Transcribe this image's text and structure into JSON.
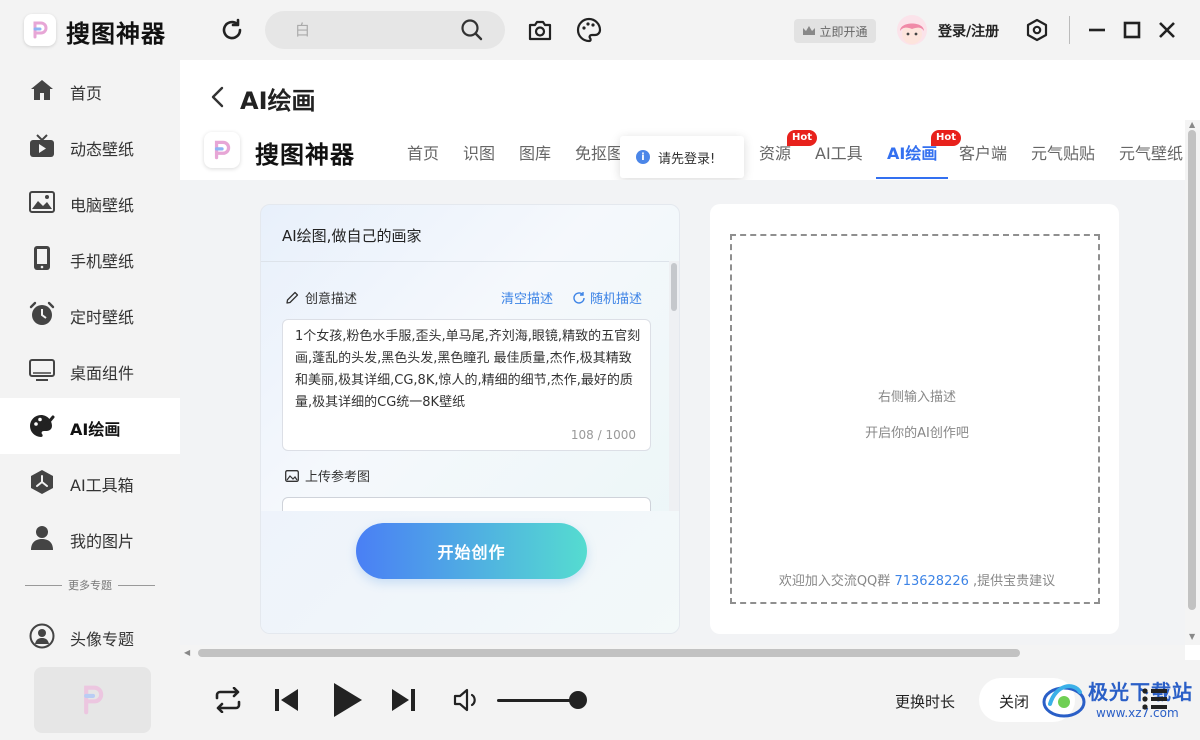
{
  "app": {
    "title": "搜图神器",
    "search_placeholder": "白",
    "vip_label": "立即开通",
    "login_label": "登录/注册"
  },
  "sidebar": {
    "items": [
      {
        "label": "首页",
        "icon": "home-icon"
      },
      {
        "label": "动态壁纸",
        "icon": "tv-icon"
      },
      {
        "label": "电脑壁纸",
        "icon": "image-icon"
      },
      {
        "label": "手机壁纸",
        "icon": "phone-icon"
      },
      {
        "label": "定时壁纸",
        "icon": "alarm-clock-icon"
      },
      {
        "label": "桌面组件",
        "icon": "monitor-icon"
      },
      {
        "label": "AI绘画",
        "icon": "palette-icon"
      },
      {
        "label": "AI工具箱",
        "icon": "ai-toolbox-icon"
      },
      {
        "label": "我的图片",
        "icon": "user-icon"
      }
    ],
    "more_topics": "更多专题",
    "topic_items": [
      {
        "label": "头像专题",
        "icon": "avatar-topic-icon"
      }
    ],
    "active": "AI绘画"
  },
  "page": {
    "title": "AI绘画",
    "site_brand": "搜图神器",
    "nav": [
      {
        "label": "首页"
      },
      {
        "label": "识图"
      },
      {
        "label": "图库"
      },
      {
        "label": "免抠图"
      },
      {
        "label": "资源",
        "badge": "Hot"
      },
      {
        "label": "AI工具"
      },
      {
        "label": "AI绘画",
        "badge": "Hot",
        "active": true
      },
      {
        "label": "客户端"
      },
      {
        "label": "元气贴贴"
      },
      {
        "label": "元气壁纸"
      }
    ],
    "toast": "请先登录!"
  },
  "left_card": {
    "title": "AI绘图,做自己的画家",
    "creative_label": "创意描述",
    "clear_label": "清空描述",
    "random_label": "随机描述",
    "description": "1个女孩,粉色水手服,歪头,单马尾,齐刘海,眼镜,精致的五官刻画,蓬乱的头发,黑色头发,黑色瞳孔 最佳质量,杰作,极其精致和美丽,极其详细,CG,8K,惊人的,精细的细节,杰作,最好的质量,极其详细的CG统一8K壁纸",
    "count": "108 / 1000",
    "upload_label": "上传参考图",
    "start_button": "开始创作"
  },
  "right_card": {
    "hint1": "右侧输入描述",
    "hint2": "开启你的AI创作吧",
    "qq_prefix": "欢迎加入交流QQ群",
    "qq_number": "713628226",
    "qq_suffix": ",提供宝贵建议"
  },
  "player": {
    "change_duration": "更换时长",
    "close": "关闭",
    "volume_level": 0.88
  },
  "watermark": {
    "text1": "极光下载站",
    "text2": "www.xz7.com"
  },
  "colors": {
    "accent": "#3370f0",
    "hot": "#e8211c",
    "link": "#3d84e6"
  }
}
